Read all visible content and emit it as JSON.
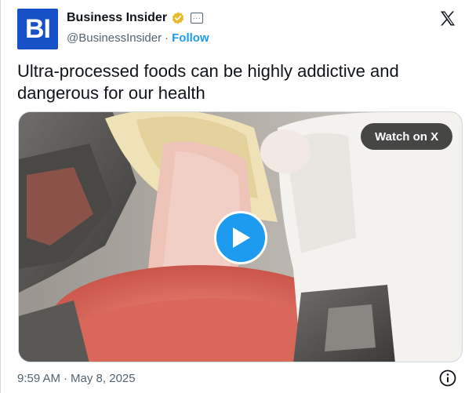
{
  "author": {
    "avatar_text": "BI",
    "display_name": "Business Insider",
    "handle": "@BusinessInsider",
    "separator": "·",
    "follow_label": "Follow",
    "brand_color": "#1651c7",
    "verified_color": "#e8b828"
  },
  "tweet": {
    "text": "Ultra-processed foods can be highly addictive and dangerous for our health"
  },
  "media": {
    "watch_label": "Watch on X",
    "type": "video"
  },
  "footer": {
    "time": "9:59 AM",
    "separator": "·",
    "date": "May 8, 2025"
  },
  "icons": [
    "verified-badge-icon",
    "affiliate-badge-icon",
    "x-logo-icon",
    "play-icon",
    "info-icon"
  ],
  "colors": {
    "accent": "#1d9bf0",
    "text": "#0f1419",
    "muted": "#536471"
  }
}
